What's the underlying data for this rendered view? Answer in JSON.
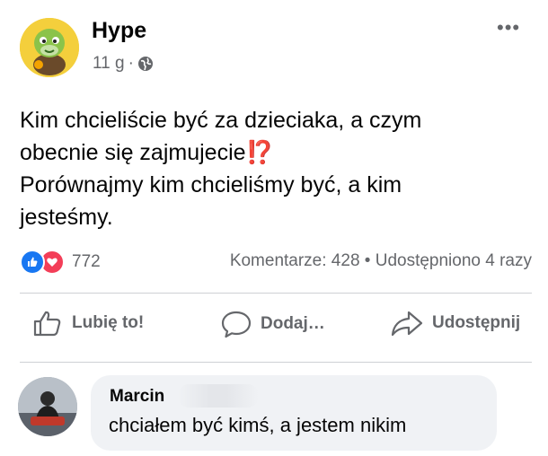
{
  "post": {
    "author": "Hype",
    "time": "11 g",
    "separator": "·",
    "more_label": "•••",
    "text_lines": [
      "Kim chcieliście być za dzieciaka, a czym",
      "obecnie się zajmujecie",
      "Porównajmy kim chcieliśmy być, a kim",
      "jesteśmy."
    ],
    "emoji": "⁉️",
    "reactions_count": "772",
    "stats": "Komentarze: 428 • Udostępniono 4 razy"
  },
  "actions": {
    "like": "Lubię to!",
    "comment": "Dodaj…",
    "share": "Udostępnij"
  },
  "comment": {
    "author": "Marcin",
    "text": "chciałem być kimś, a jestem nikim"
  },
  "colors": {
    "primary_text": "#050505",
    "secondary_text": "#65676b",
    "like_blue": "#1877f2",
    "love_red": "#f33e58",
    "bubble_bg": "#f0f2f5",
    "avatar_bg": "#f4cf3c"
  },
  "icons": [
    "turtle-avatar",
    "globe-icon",
    "more-icon",
    "like-reaction-icon",
    "love-reaction-icon",
    "thumbs-up-icon",
    "comment-icon",
    "share-icon"
  ]
}
